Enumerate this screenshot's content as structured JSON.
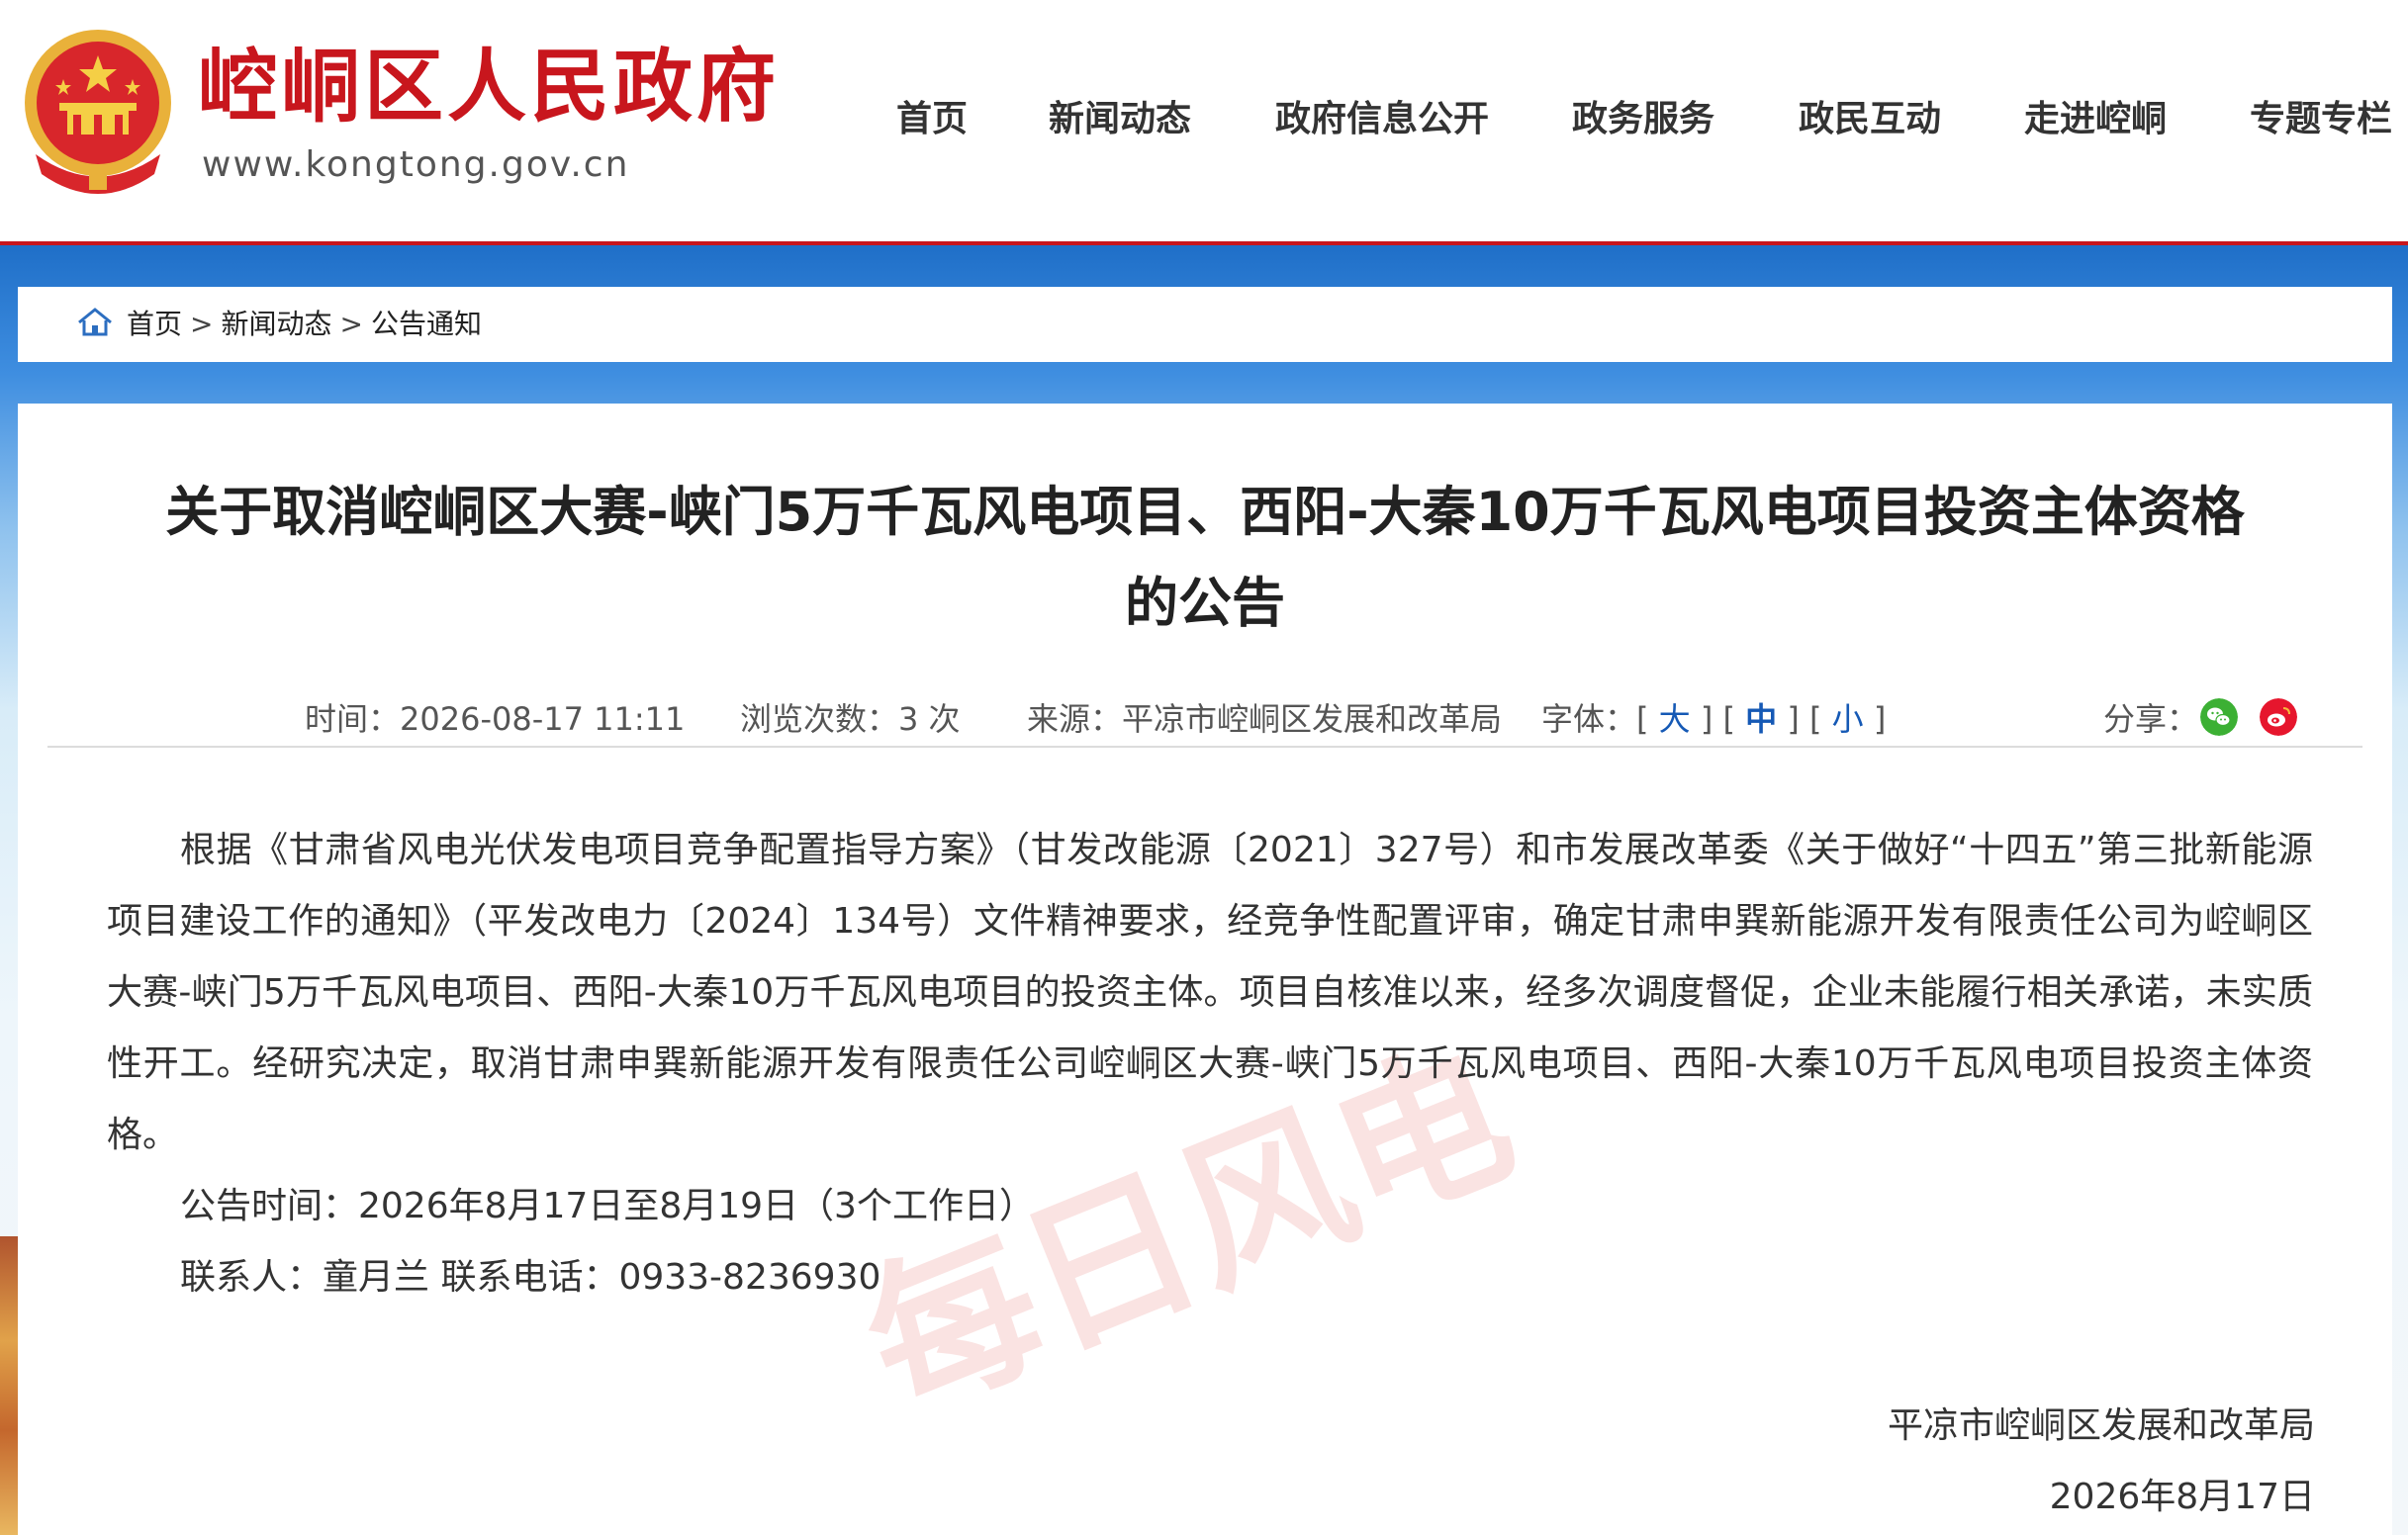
{
  "site": {
    "name": "崆峒区人民政府",
    "url": "www.kongtong.gov.cn",
    "emblem_icon": "national-emblem-icon"
  },
  "nav": {
    "items": [
      {
        "label": "首页"
      },
      {
        "label": "新闻动态"
      },
      {
        "label": "政府信息公开"
      },
      {
        "label": "政务服务"
      },
      {
        "label": "政民互动"
      },
      {
        "label": "走进崆峒"
      },
      {
        "label": "专题专栏"
      }
    ]
  },
  "breadcrumb": {
    "icon": "home-icon",
    "items": [
      "首页",
      "新闻动态",
      "公告通知"
    ],
    "separator": ">"
  },
  "article": {
    "title": "关于取消崆峒区大赛-峡门5万千瓦风电项目、西阳-大秦10万千瓦风电项目投资主体资格的公告",
    "meta": {
      "time_label": "时间：",
      "time": "2026-08-17 11:11",
      "views_label": "浏览次数：",
      "views": "3 次",
      "source_label": "来源：",
      "source": "平凉市崆峒区发展和改革局",
      "font_label": "字体：",
      "font_large": "大",
      "font_medium": "中",
      "font_small": "小",
      "share_label": "分享："
    },
    "paragraphs": [
      "根据《甘肃省风电光伏发电项目竞争配置指导方案》（甘发改能源〔2021〕327号）和市发展改革委《关于做好“十四五”第三批新能源项目建设工作的通知》（平发改电力〔2024〕134号）文件精神要求，经竞争性配置评审，确定甘肃申巽新能源开发有限责任公司为崆峒区大赛-峡门5万千瓦风电项目、西阳-大秦10万千瓦风电项目的投资主体。项目自核准以来，经多次调度督促，企业未能履行相关承诺，未实质性开工。经研究决定，取消甘肃申巽新能源开发有限责任公司崆峒区大赛-峡门5万千瓦风电项目、西阳-大秦10万千瓦风电项目投资主体资格。",
      "公告时间：2026年8月17日至8月19日（3个工作日）",
      "联系人：童月兰  联系电话：0933-8236930"
    ],
    "signature": "平凉市崆峒区发展和改革局",
    "date": "2026年8月17日"
  },
  "watermark": {
    "text": "每日风电"
  },
  "colors": {
    "brand_red": "#c8161d",
    "link_blue": "#1559b5",
    "wechat_green": "#3cb034",
    "weibo_red": "#e6162d"
  }
}
